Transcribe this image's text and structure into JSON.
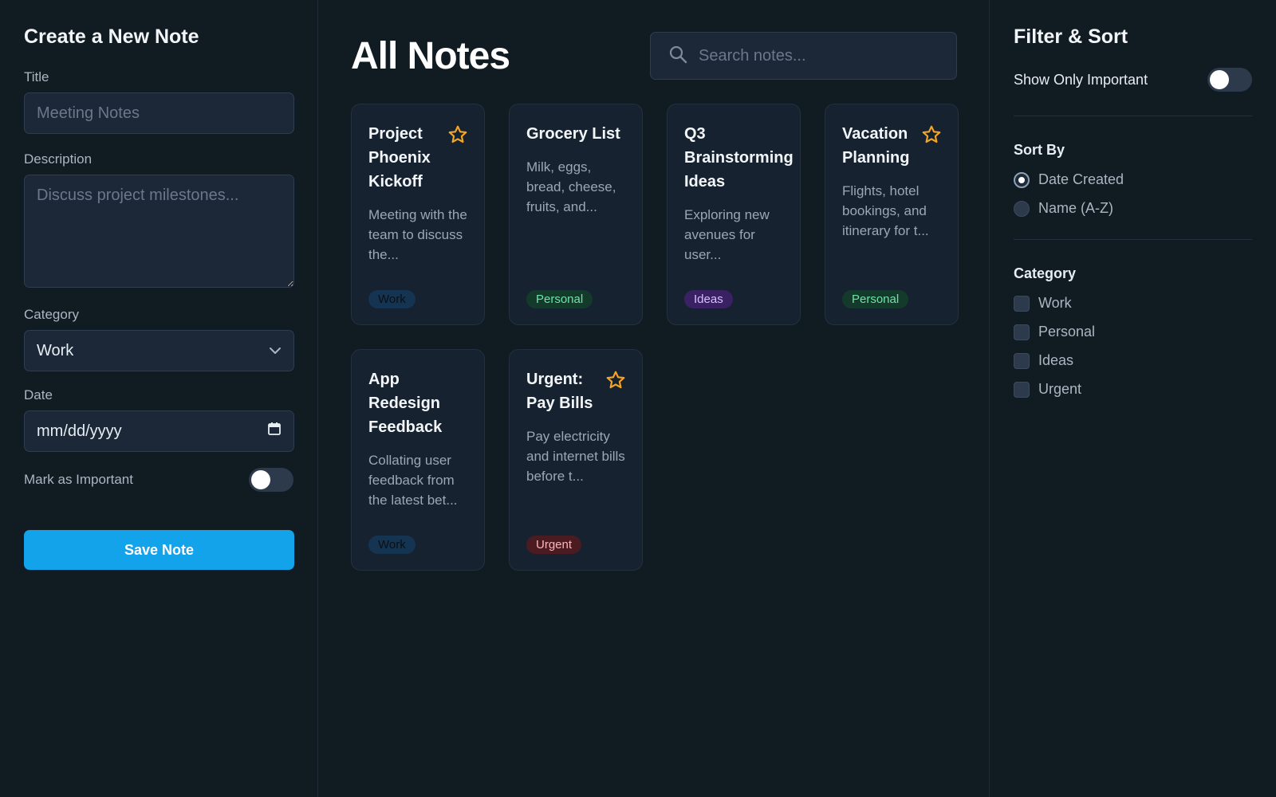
{
  "create": {
    "title": "Create a New Note",
    "title_label": "Title",
    "title_placeholder": "Meeting Notes",
    "description_label": "Description",
    "description_placeholder": "Discuss project milestones...",
    "category_label": "Category",
    "category_value": "Work",
    "date_label": "Date",
    "date_value": "mm/dd/yyyy",
    "important_label": "Mark as Important",
    "important_on": false,
    "save_label": "Save Note"
  },
  "main": {
    "title": "All Notes",
    "search_placeholder": "Search notes...",
    "notes": [
      {
        "title": "Project Phoenix Kickoff",
        "description": "Meeting with the team to discuss the...",
        "tag": "Work",
        "starred": true
      },
      {
        "title": "Grocery List",
        "description": "Milk, eggs, bread, cheese, fruits, and...",
        "tag": "Personal",
        "starred": false
      },
      {
        "title": "Q3 Brainstorming Ideas",
        "description": "Exploring new avenues for user...",
        "tag": "Ideas",
        "starred": false
      },
      {
        "title": "Vacation Planning",
        "description": "Flights, hotel bookings, and itinerary for t...",
        "tag": "Personal",
        "starred": true
      },
      {
        "title": "App Redesign Feedback",
        "description": "Collating user feedback from the latest bet...",
        "tag": "Work",
        "starred": false
      },
      {
        "title": "Urgent: Pay Bills",
        "description": "Pay electricity and internet bills before t...",
        "tag": "Urgent",
        "starred": true
      }
    ]
  },
  "filters": {
    "title": "Filter & Sort",
    "only_important_label": "Show Only Important",
    "only_important_on": false,
    "sort_label": "Sort By",
    "sort_options": [
      "Date Created",
      "Name (A-Z)"
    ],
    "sort_selected": "Date Created",
    "category_label": "Category",
    "categories": [
      "Work",
      "Personal",
      "Ideas",
      "Urgent"
    ]
  },
  "colors": {
    "accent": "#12a3ea",
    "star": "#f5a524",
    "tag_work_bg": "#153451",
    "tag_work_fg": "#0b0f14",
    "tag_personal_bg": "#143a2c",
    "tag_personal_fg": "#6fe3a7",
    "tag_ideas_bg": "#3a2163",
    "tag_ideas_fg": "#d6c2ff",
    "tag_urgent_bg": "#4a1c22",
    "tag_urgent_fg": "#ffb4b8"
  }
}
